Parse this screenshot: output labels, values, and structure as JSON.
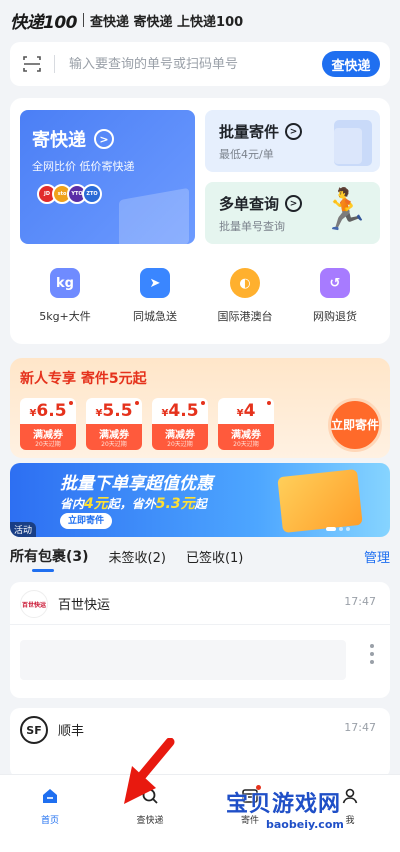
{
  "header": {
    "logo": "快递100",
    "slogan": "查快递 寄快递 上快递100"
  },
  "search": {
    "placeholder": "输入要查询的单号或扫码单号",
    "button": "查快递"
  },
  "services": {
    "send": {
      "title": "寄快递",
      "subtitle": "全网比价 低价寄快递",
      "carriers": [
        "JD",
        "sto",
        "YTO",
        "ZTO"
      ]
    },
    "batch": {
      "title": "批量寄件",
      "subtitle": "最低4元/单"
    },
    "multi": {
      "title": "多单查询",
      "subtitle": "批量单号查询"
    },
    "shortcuts": [
      {
        "label": "5kg+大件",
        "icon": "scale-icon",
        "glyph": "kg",
        "color": "#6f8bff"
      },
      {
        "label": "同城急送",
        "icon": "runner-icon",
        "glyph": "➤",
        "color": "#3a86ff"
      },
      {
        "label": "国际港澳台",
        "icon": "globe-icon",
        "glyph": "◐",
        "color": "#ffb02e"
      },
      {
        "label": "网购退货",
        "icon": "return-icon",
        "glyph": "↺",
        "color": "#a77bff"
      }
    ]
  },
  "promo": {
    "title": "新人专享 寄件5元起",
    "coupons": [
      {
        "amount": "6.5",
        "name": "满减券",
        "expire": "20天过期"
      },
      {
        "amount": "5.5",
        "name": "满减券",
        "expire": "20天过期"
      },
      {
        "amount": "4.5",
        "name": "满减券",
        "expire": "20天过期"
      },
      {
        "amount": "4",
        "name": "满减券",
        "expire": "20天过期"
      }
    ],
    "currency": "¥",
    "button": "立即寄件"
  },
  "banner": {
    "title": "批量下单享超值优惠",
    "sub_a": "省内",
    "sub_b": "4元",
    "sub_c": "起，省外",
    "sub_d": "5.3元",
    "sub_e": "起",
    "button": "立即寄件",
    "tag": "活动"
  },
  "tabs": {
    "all": "所有包裹",
    "all_count": "(3)",
    "unsigned": "未签收(2)",
    "signed": "已签收(1)",
    "manage": "管理"
  },
  "packages": [
    {
      "carrier": "百世快运",
      "time": "17:47",
      "logo_text": "百世快运"
    },
    {
      "carrier": "顺丰",
      "time": "17:47",
      "logo_text": "SF"
    }
  ],
  "nav": [
    {
      "label": "首页",
      "icon": "home-icon"
    },
    {
      "label": "查快递",
      "icon": "search-icon"
    },
    {
      "label": "寄件",
      "icon": "box-icon"
    },
    {
      "label": "我",
      "icon": "user-icon"
    }
  ],
  "watermark": {
    "text": "宝贝游戏网",
    "url": "baobeiy.com"
  },
  "colors": {
    "accent": "#1f6ff0",
    "promo_red": "#e5321c",
    "page_bg": "#f2f4f7"
  }
}
